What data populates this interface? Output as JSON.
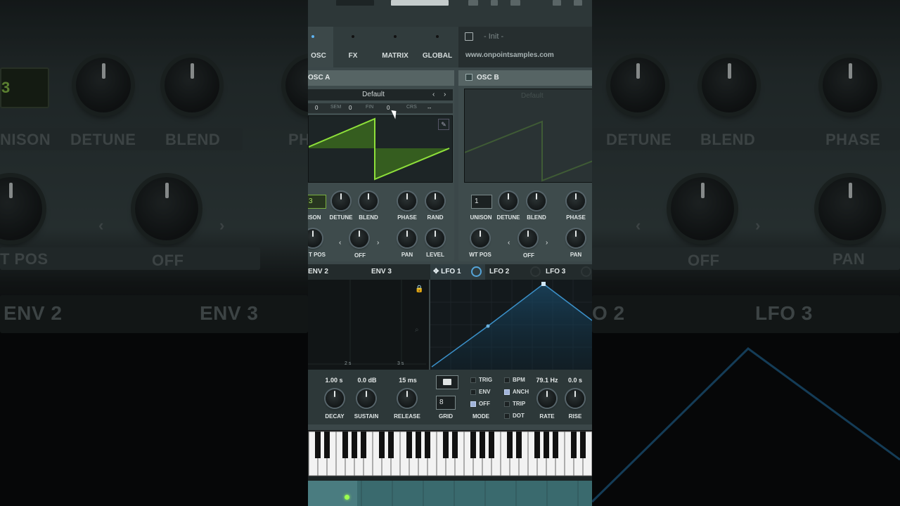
{
  "background": {
    "left_labels": [
      "NISON",
      "DETUNE",
      "BLEND",
      "PH",
      "T POS",
      "OFF",
      "ENV 2",
      "ENV 3"
    ],
    "left_unison_value": "3",
    "right_labels": [
      "DETUNE",
      "BLEND",
      "PHASE",
      "OFF",
      "PAN",
      "O 2",
      "LFO 3"
    ]
  },
  "tabs": [
    "OSC",
    "FX",
    "MATRIX",
    "GLOBAL"
  ],
  "preset": {
    "name": "- Init -",
    "url": "www.onpointsamples.com"
  },
  "osc_a": {
    "title": "OSC  A",
    "wavetable": "Default",
    "sub": {
      "oct": "0",
      "sem_label": "SEM",
      "sem": "0",
      "fin_label": "FIN",
      "fin": "0",
      "crs_label": "CRS",
      "crs": "--"
    },
    "unison": "3",
    "knobs": [
      "UNISON",
      "DETUNE",
      "BLEND",
      "PHASE",
      "RAND"
    ],
    "knobs2": [
      "T POS",
      "OFF",
      "PAN",
      "LEVEL"
    ]
  },
  "osc_b": {
    "title": "OSC  B",
    "wavetable": "Default",
    "unison": "1",
    "knobs": [
      "UNISON",
      "DETUNE",
      "BLEND",
      "PHASE"
    ],
    "knobs2": [
      "WT POS",
      "OFF",
      "PAN"
    ]
  },
  "mod_tabs": [
    "ENV 2",
    "ENV 3",
    "LFO 1",
    "LFO 2",
    "LFO 3"
  ],
  "env": {
    "time_labels": [
      "2 s",
      "3 s"
    ],
    "values": [
      "1.00 s",
      "0.0 dB",
      "15 ms"
    ],
    "labels": [
      "DECAY",
      "SUSTAIN",
      "RELEASE"
    ]
  },
  "lfo": {
    "grid_value": "8",
    "grid_label": "GRID",
    "mode_label": "MODE",
    "mode_opts": [
      "TRIG",
      "ENV",
      "OFF"
    ],
    "sync_opts": [
      "BPM",
      "ANCH",
      "TRIP",
      "DOT"
    ],
    "rate_value": "79.1 Hz",
    "rise_value": "0.0 s",
    "rate_label": "RATE",
    "rise_label": "RISE"
  }
}
